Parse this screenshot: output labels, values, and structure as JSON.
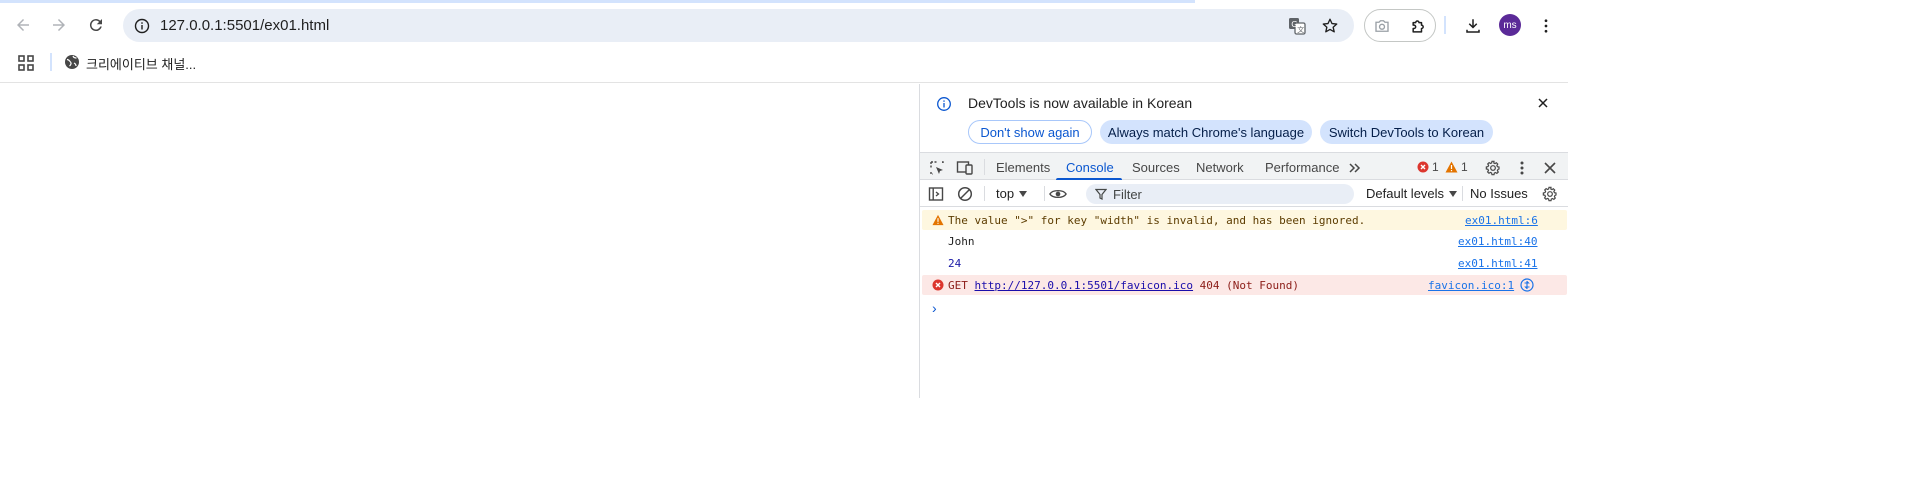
{
  "browser": {
    "url": "127.0.0.1:5501/ex01.html",
    "avatar_initials": "ms",
    "bookmark_label": "크리에이티브 채널...",
    "icons": [
      "back-icon",
      "forward-icon",
      "reload-icon",
      "site-info-icon",
      "translate-icon",
      "star-icon",
      "camera-icon",
      "extensions-icon",
      "download-icon",
      "more-icon",
      "apps-icon",
      "globe-icon"
    ]
  },
  "devtools": {
    "infobar": {
      "message": "DevTools is now available in Korean",
      "dont_show": "Don't show again",
      "always_match": "Always match Chrome's language",
      "switch_lang": "Switch DevTools to Korean"
    },
    "tabs": [
      "Elements",
      "Console",
      "Sources",
      "Network",
      "Performance"
    ],
    "active_tab": "Console",
    "error_count": "1",
    "warning_count": "1",
    "console_bar": {
      "context": "top",
      "filter_placeholder": "Filter",
      "levels": "Default levels",
      "issues": "No Issues"
    },
    "messages": [
      {
        "level": "warning",
        "text": "The value \">\" for key \"width\" is invalid, and has been ignored.",
        "source": "ex01.html:6"
      },
      {
        "level": "log",
        "text": "John",
        "source": "ex01.html:40"
      },
      {
        "level": "log",
        "text": "24",
        "source": "ex01.html:41"
      },
      {
        "level": "error",
        "method": "GET",
        "url": "http://127.0.0.1:5501/favicon.ico",
        "status": "404 (Not Found)",
        "source": "favicon.ico:1"
      }
    ],
    "prompt": "›"
  },
  "colors": {
    "accent": "#0b57d0",
    "warning_bg": "#fef7e0",
    "error_bg": "#fce8e6",
    "error_icon": "#dc362e",
    "warning_icon": "#e37400",
    "avatar": "#5b2a98"
  }
}
